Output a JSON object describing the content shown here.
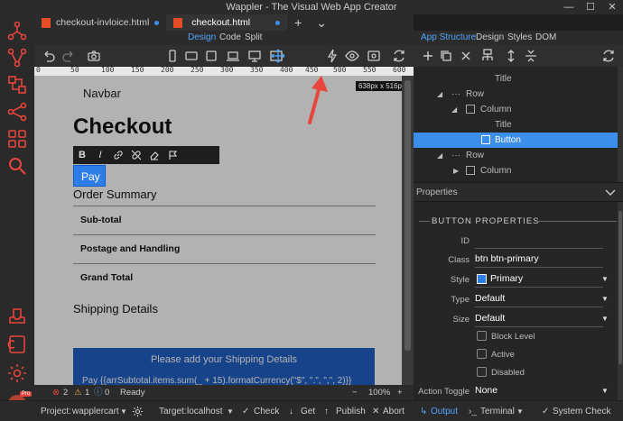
{
  "window": {
    "title": "Wappler - The Visual Web App Creator",
    "controls": [
      "—",
      "☐",
      "✕"
    ]
  },
  "tabs": [
    {
      "label": "checkout-invloice.html",
      "active": false
    },
    {
      "label": "checkout.html",
      "active": true
    }
  ],
  "tab_add": "+",
  "tab_more": "⌄",
  "view_modes": {
    "design": "Design",
    "code": "Code",
    "split": "Split"
  },
  "right_tabs": {
    "structure": "App Structure",
    "design": "Design",
    "styles": "Styles",
    "dom": "DOM"
  },
  "ruler": {
    "marks": [
      "0",
      "50",
      "100",
      "150",
      "200",
      "250",
      "300",
      "350",
      "400",
      "450",
      "500",
      "550",
      "600"
    ],
    "size_badge": "638px x 516px"
  },
  "canvas": {
    "navbar": "Navbar",
    "heading": "Checkout",
    "format_tools": [
      "B",
      "I",
      "link",
      "unlink",
      "eraser",
      "flag"
    ],
    "pay_button": "Pay",
    "order_summary": "Order Summary",
    "rows": [
      "Sub-total",
      "Postage and Handling",
      "Grand Total"
    ],
    "shipping": "Shipping Details",
    "alert_text": "Please add your Shipping Details",
    "alert_code": "Pay {{arrSubtotal.items.sum(_ + 15).formatCurrency(\"$\", \".\", \",\", 2)}}"
  },
  "canvas_status": {
    "errors": "2",
    "warnings": "1",
    "info": "0",
    "ready": "Ready",
    "zoom": "100%"
  },
  "tree": [
    {
      "label": "Title",
      "level": 3,
      "icon": "none",
      "toggle": "none"
    },
    {
      "label": "Row",
      "level": 1,
      "icon": "dots",
      "toggle": "open"
    },
    {
      "label": "Column",
      "level": 2,
      "icon": "column",
      "toggle": "open"
    },
    {
      "label": "Title",
      "level": 3,
      "icon": "none",
      "toggle": "none"
    },
    {
      "label": "Button",
      "level": 3,
      "icon": "button",
      "toggle": "none",
      "selected": true
    },
    {
      "label": "Row",
      "level": 1,
      "icon": "dots",
      "toggle": "open"
    },
    {
      "label": "Column",
      "level": 2,
      "icon": "column",
      "toggle": "closed"
    }
  ],
  "properties": {
    "header": "Properties",
    "section": "BUTTON PROPERTIES",
    "id_label": "ID",
    "id_value": "",
    "class_label": "Class",
    "class_value": "btn btn-primary",
    "style_label": "Style",
    "style_value": "Primary",
    "style_color": "#2f7ee8",
    "type_label": "Type",
    "type_value": "Default",
    "size_label": "Size",
    "size_value": "Default",
    "checkboxes": [
      "Block Level",
      "Active",
      "Disabled"
    ],
    "action_label": "Action Toggle",
    "action_value": "None"
  },
  "bottom": {
    "project_label": "Project:",
    "project_value": "wapplercart",
    "target_label": "Target:",
    "target_value": "localhost",
    "check": "Check",
    "get": "Get",
    "publish": "Publish",
    "abort": "Abort",
    "output": "Output",
    "terminal": "Terminal",
    "system_check": "System Check"
  },
  "colors": {
    "accent": "#3b8eea",
    "primary_button": "#2f7ee8",
    "arrow": "#e8453c",
    "html_badge": "#e44d26"
  }
}
